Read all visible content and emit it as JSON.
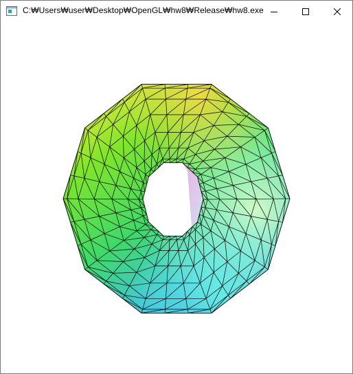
{
  "window": {
    "title": "C:₩Users₩user₩Desktop₩OpenGL₩hw8₩Release₩hw8.exe",
    "buttons": {
      "minimize_icon": "minimize-icon",
      "maximize_icon": "maximize-icon",
      "close_icon": "close-icon"
    }
  },
  "scene": {
    "object": "torus",
    "render_mode": "shaded-with-wireframe",
    "major_segments": 10,
    "minor_segments": 12,
    "colors": {
      "top": "#f2e840",
      "upper_left": "#62e21e",
      "left": "#36d84e",
      "bottom_left": "#3ab0e6",
      "bottom_right": "#63f3e2",
      "right": "#c4fbb0",
      "inner_pink": "#e9a0d8",
      "wire": "#000000",
      "background": "#ffffff"
    }
  }
}
